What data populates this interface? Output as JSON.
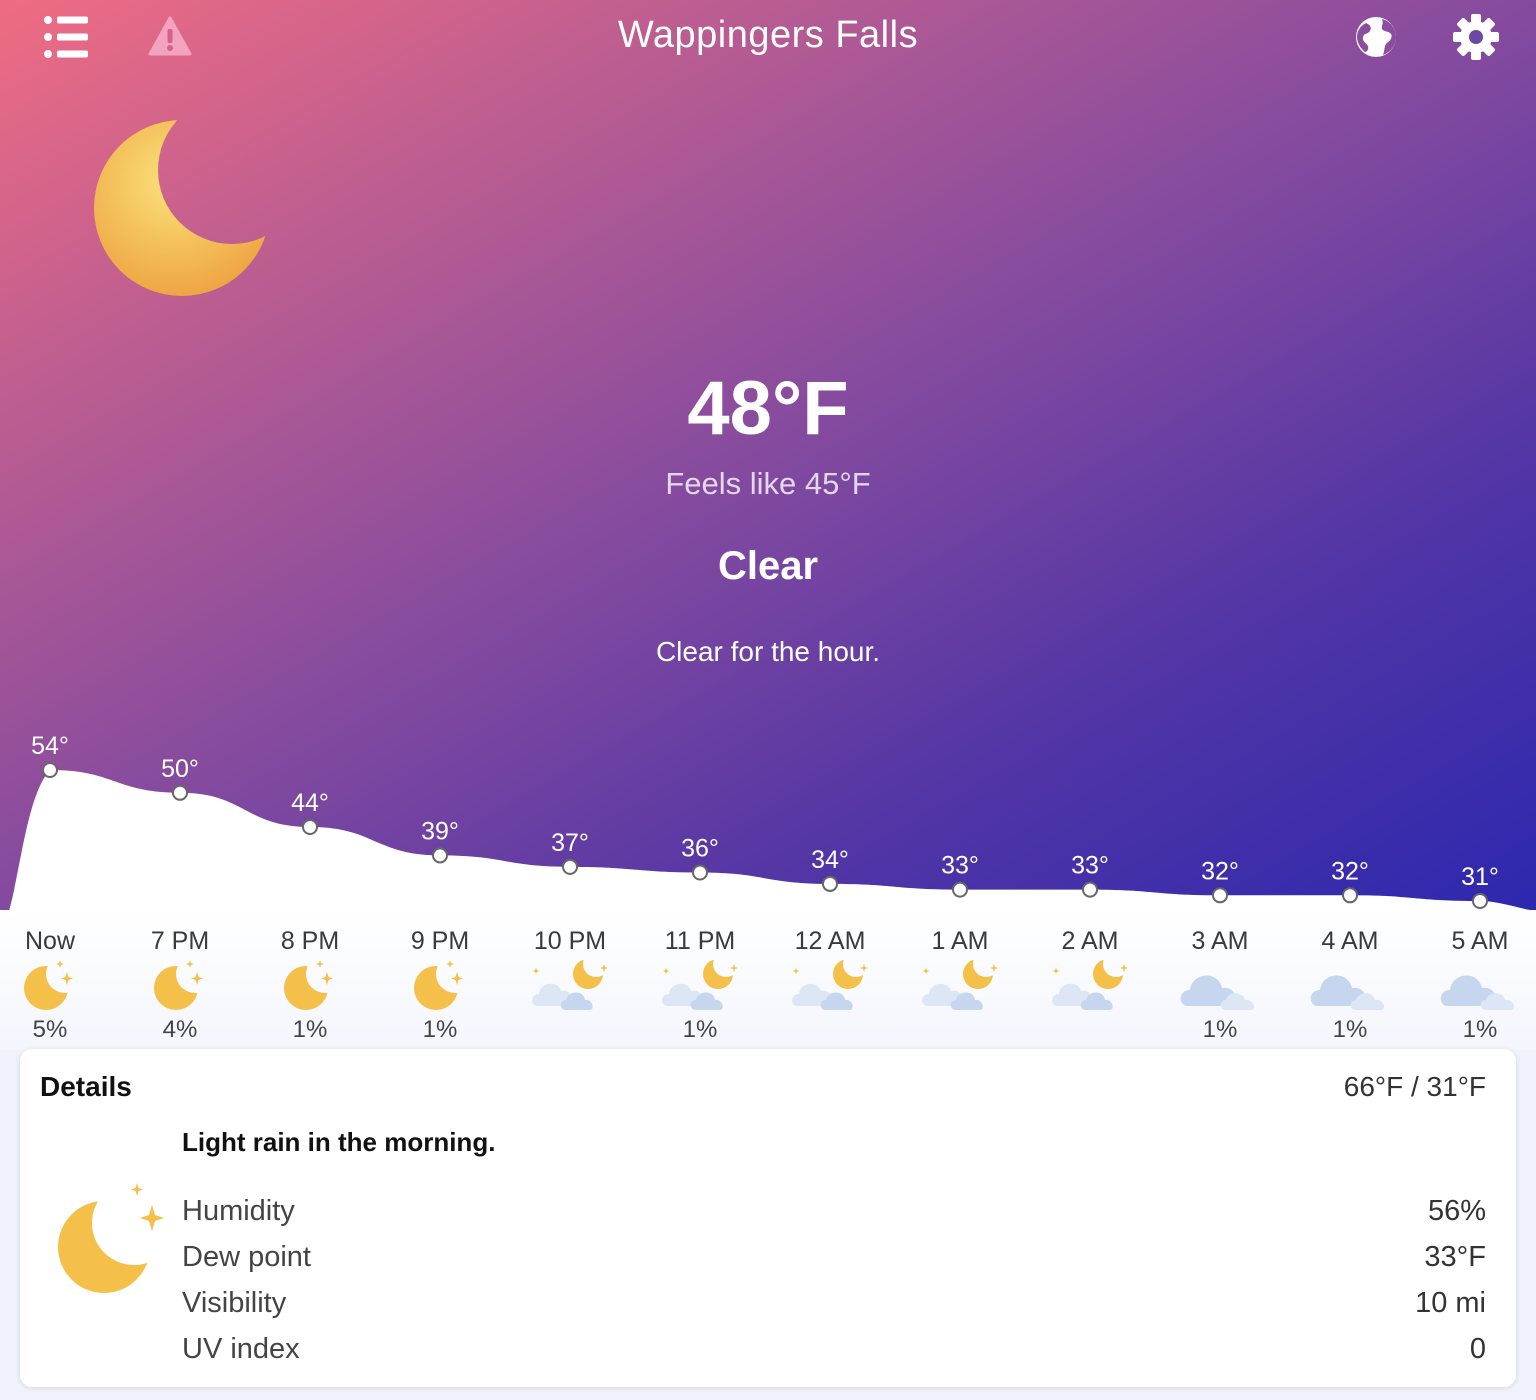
{
  "header": {
    "city": "Wappingers Falls",
    "icons": [
      "list-icon",
      "alert-icon",
      "globe-icon",
      "gear-icon"
    ]
  },
  "current": {
    "temperature": "48°F",
    "feels_like": "Feels like 45°F",
    "condition": "Clear",
    "summary": "Clear for the hour.",
    "icon": "moon-icon"
  },
  "hourly": [
    {
      "time": "Now",
      "temp": "54°",
      "icon": "moon-stars-icon",
      "precip": "5%"
    },
    {
      "time": "7 PM",
      "temp": "50°",
      "icon": "moon-stars-icon",
      "precip": "4%"
    },
    {
      "time": "8 PM",
      "temp": "44°",
      "icon": "moon-stars-icon",
      "precip": "1%"
    },
    {
      "time": "9 PM",
      "temp": "39°",
      "icon": "moon-stars-icon",
      "precip": "1%"
    },
    {
      "time": "10 PM",
      "temp": "37°",
      "icon": "partly-cloudy-night-icon",
      "precip": ""
    },
    {
      "time": "11 PM",
      "temp": "36°",
      "icon": "partly-cloudy-night-icon",
      "precip": "1%"
    },
    {
      "time": "12 AM",
      "temp": "34°",
      "icon": "partly-cloudy-night-icon",
      "precip": ""
    },
    {
      "time": "1 AM",
      "temp": "33°",
      "icon": "partly-cloudy-night-icon",
      "precip": ""
    },
    {
      "time": "2 AM",
      "temp": "33°",
      "icon": "partly-cloudy-night-icon",
      "precip": ""
    },
    {
      "time": "3 AM",
      "temp": "32°",
      "icon": "cloudy-icon",
      "precip": "1%"
    },
    {
      "time": "4 AM",
      "temp": "32°",
      "icon": "cloudy-icon",
      "precip": "1%"
    },
    {
      "time": "5 AM",
      "temp": "31°",
      "icon": "cloudy-icon",
      "precip": "1%"
    }
  ],
  "details": {
    "title": "Details",
    "range": "66°F / 31°F",
    "description": "Light rain in the morning.",
    "icon": "moon-stars-icon",
    "rows": [
      {
        "label": "Humidity",
        "value": "56%"
      },
      {
        "label": "Dew point",
        "value": "33°F"
      },
      {
        "label": "Visibility",
        "value": "10 mi"
      },
      {
        "label": "UV index",
        "value": "0"
      }
    ]
  },
  "colors": {
    "gradient_start": "#ef6c83",
    "gradient_end": "#2a27af",
    "moon": "#f5c04a",
    "cloud": "#c6d6ef"
  }
}
